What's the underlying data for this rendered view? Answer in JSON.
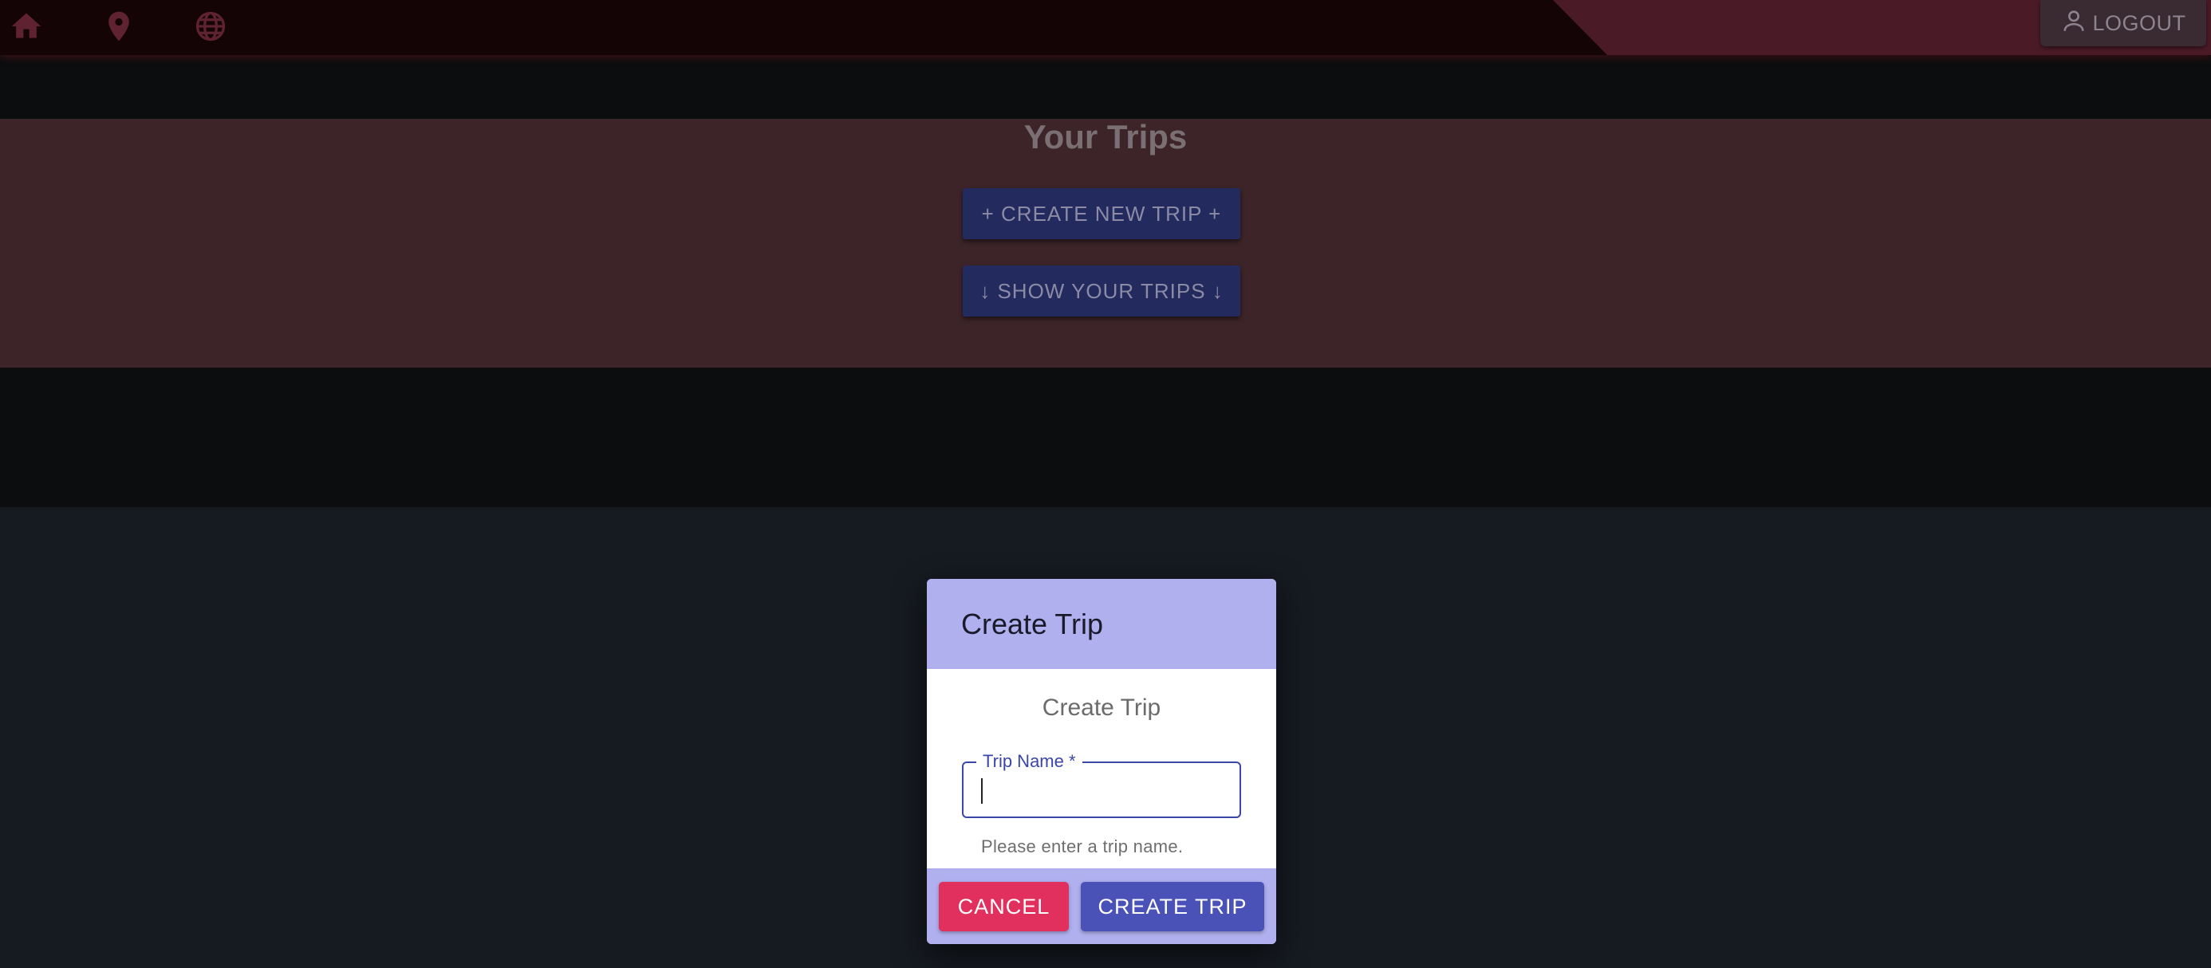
{
  "nav": {
    "icons": [
      "home-icon",
      "location-pin-icon",
      "globe-icon"
    ],
    "logout_label": "LOGOUT"
  },
  "trips": {
    "title": "Your Trips",
    "create_new_label": "+ CREATE NEW TRIP +",
    "show_label": "↓ SHOW YOUR TRIPS ↓"
  },
  "dialog": {
    "header_title": "Create Trip",
    "body_title": "Create Trip",
    "field": {
      "label": "Trip Name *",
      "value": "",
      "helper_text": "Please enter a trip name."
    },
    "cancel_label": "CANCEL",
    "create_label": "CREATE TRIP"
  },
  "colors": {
    "topbar": "#140405",
    "topbar_accent": "#4a1b27",
    "trips_panel": "#3d2429",
    "dialog_accent": "#b0b0ef",
    "cancel_button": "#e2305e",
    "primary_button": "#4a52b8"
  }
}
